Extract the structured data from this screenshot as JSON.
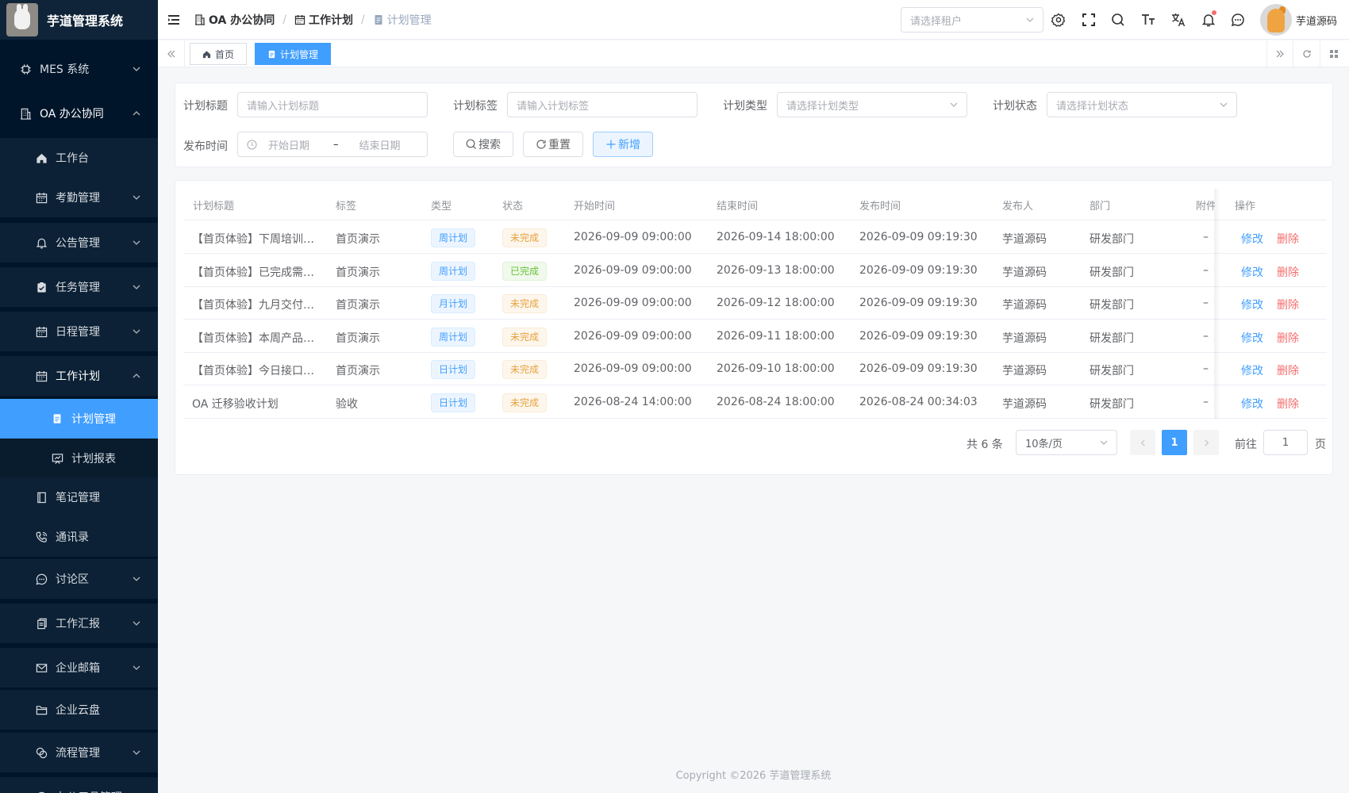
{
  "app": {
    "title": "芋道管理系统"
  },
  "sidebar": {
    "items": [
      {
        "label": "MES 系统",
        "icon": "chip-icon",
        "level": 1,
        "arrow": "down"
      },
      {
        "label": "OA 办公协同",
        "icon": "building-icon",
        "level": 1,
        "arrow": "up"
      },
      {
        "label": "工作台",
        "icon": "home-icon",
        "level": 2,
        "arrow": ""
      },
      {
        "label": "考勤管理",
        "icon": "calendar-icon",
        "level": 2,
        "arrow": "down"
      },
      {
        "label": "公告管理",
        "icon": "bell-icon",
        "level": 2,
        "arrow": "down"
      },
      {
        "label": "任务管理",
        "icon": "task-icon",
        "level": 2,
        "arrow": "down"
      },
      {
        "label": "日程管理",
        "icon": "calendar-icon",
        "level": 2,
        "arrow": "down"
      },
      {
        "label": "工作计划",
        "icon": "calendar-icon",
        "level": 2,
        "arrow": "up"
      },
      {
        "label": "计划管理",
        "icon": "doc-icon",
        "level": 3,
        "arrow": ""
      },
      {
        "label": "计划报表",
        "icon": "report-icon",
        "level": 3,
        "arrow": ""
      },
      {
        "label": "笔记管理",
        "icon": "notebook-icon",
        "level": 2,
        "arrow": ""
      },
      {
        "label": "通讯录",
        "icon": "phone-icon",
        "level": 2,
        "arrow": ""
      },
      {
        "label": "讨论区",
        "icon": "chat-icon",
        "level": 2,
        "arrow": "down"
      },
      {
        "label": "工作汇报",
        "icon": "copy-icon",
        "level": 2,
        "arrow": "down"
      },
      {
        "label": "企业邮箱",
        "icon": "mail-icon",
        "level": 2,
        "arrow": "down"
      },
      {
        "label": "企业云盘",
        "icon": "folder-icon",
        "level": 2,
        "arrow": ""
      },
      {
        "label": "流程管理",
        "icon": "flow-icon",
        "level": 2,
        "arrow": "down"
      },
      {
        "label": "办公用品管理",
        "icon": "box-icon",
        "level": 2,
        "arrow": ""
      }
    ],
    "active_index": 8
  },
  "header": {
    "breadcrumb": [
      "OA 办公协同",
      "工作计划",
      "计划管理"
    ],
    "tenant_placeholder": "请选择租户",
    "user_name": "芋道源码"
  },
  "tags": {
    "home": "首页",
    "current": "计划管理"
  },
  "search": {
    "title_label": "计划标题",
    "title_placeholder": "请输入计划标题",
    "tag_label": "计划标签",
    "tag_placeholder": "请输入计划标签",
    "type_label": "计划类型",
    "type_placeholder": "请选择计划类型",
    "status_label": "计划状态",
    "status_placeholder": "请选择计划状态",
    "publish_label": "发布时间",
    "start_placeholder": "开始日期",
    "range_sep": "–",
    "end_placeholder": "结束日期",
    "search_btn": "搜索",
    "reset_btn": "重置",
    "add_btn": "新增"
  },
  "table": {
    "columns": [
      "计划标题",
      "标签",
      "类型",
      "状态",
      "开始时间",
      "结束时间",
      "发布时间",
      "发布人",
      "部门",
      "附件",
      "操作"
    ],
    "rows": [
      {
        "title": "【首页体验】下周培训计划",
        "tag": "首页演示",
        "type": "周计划",
        "status": "未完成",
        "start": "2026-09-09 09:00:00",
        "end": "2026-09-14 18:00:00",
        "publish": "2026-09-09 09:19:30",
        "publisher": "芋道源码",
        "dept": "研发部门",
        "attach": "–"
      },
      {
        "title": "【首页体验】已完成需求整理",
        "tag": "首页演示",
        "type": "周计划",
        "status": "已完成",
        "start": "2026-09-09 09:00:00",
        "end": "2026-09-13 18:00:00",
        "publish": "2026-09-09 09:19:30",
        "publisher": "芋道源码",
        "dept": "研发部门",
        "attach": "–"
      },
      {
        "title": "【首页体验】九月交付计划",
        "tag": "首页演示",
        "type": "月计划",
        "status": "未完成",
        "start": "2026-09-09 09:00:00",
        "end": "2026-09-12 18:00:00",
        "publish": "2026-09-09 09:19:30",
        "publisher": "芋道源码",
        "dept": "研发部门",
        "attach": "–"
      },
      {
        "title": "【首页体验】本周产品迭代",
        "tag": "首页演示",
        "type": "周计划",
        "status": "未完成",
        "start": "2026-09-09 09:00:00",
        "end": "2026-09-11 18:00:00",
        "publish": "2026-09-09 09:19:30",
        "publisher": "芋道源码",
        "dept": "研发部门",
        "attach": "–"
      },
      {
        "title": "【首页体验】今日接口联调",
        "tag": "首页演示",
        "type": "日计划",
        "status": "未完成",
        "start": "2026-09-09 09:00:00",
        "end": "2026-09-10 18:00:00",
        "publish": "2026-09-09 09:19:30",
        "publisher": "芋道源码",
        "dept": "研发部门",
        "attach": "–"
      },
      {
        "title": "OA 迁移验收计划",
        "tag": "验收",
        "type": "日计划",
        "status": "未完成",
        "start": "2026-08-24 14:00:00",
        "end": "2026-08-24 18:00:00",
        "publish": "2026-08-24 00:34:03",
        "publisher": "芋道源码",
        "dept": "研发部门",
        "attach": "–"
      }
    ],
    "edit_label": "修改",
    "delete_label": "删除"
  },
  "pagination": {
    "total": "共 6 条",
    "page_size": "10条/页",
    "current": "1",
    "goto_label": "前往",
    "goto_value": "1",
    "page_suffix": "页"
  },
  "footer": {
    "copyright": "Copyright ©2026 芋道管理系统"
  },
  "colors": {
    "primary": "#409eff",
    "sidebar_bg": "#001529",
    "danger": "#f56c6c",
    "warning": "#e6a23c",
    "success": "#67c23a"
  }
}
